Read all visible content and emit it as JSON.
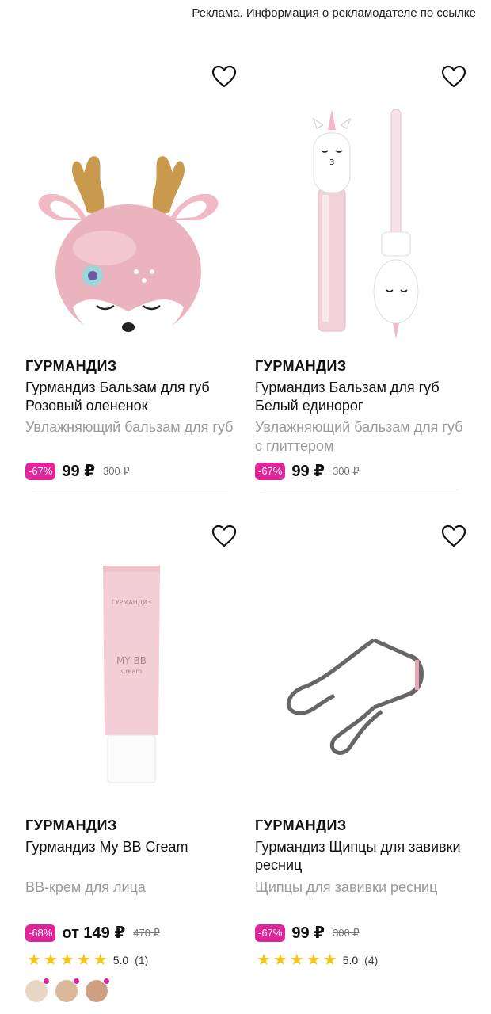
{
  "ad_notice": "Реклама. Информация о рекламодателе по ссылке",
  "products": [
    {
      "brand": "ГУРМАНДИЗ",
      "title": "Гурмандиз Бальзам для губ Розовый олененок",
      "description": "Увлажняющий бальзам для губ",
      "discount": "-67%",
      "price": "99 ₽",
      "old_price": "300 ₽",
      "image_icon": "deer-lip-balm"
    },
    {
      "brand": "ГУРМАНДИЗ",
      "title": "Гурмандиз Бальзам для губ Белый единорог",
      "description": "Увлажняющий бальзам для губ с глиттером",
      "discount": "-67%",
      "price": "99 ₽",
      "old_price": "300 ₽",
      "image_icon": "unicorn-lip-gloss"
    },
    {
      "brand": "ГУРМАНДИЗ",
      "title": "Гурмандиз My BB Cream",
      "description": "BB-крем для лица",
      "discount": "-68%",
      "price": "от 149 ₽",
      "old_price": "470 ₽",
      "rating_value": "5.0",
      "rating_count": "(1)",
      "rating_stars": 5,
      "swatch_colors": [
        "#e8d7c4",
        "#dcb89a",
        "#cf9f84"
      ],
      "image_icon": "bb-cream-tube",
      "tube_brand": "ГУРМАНДИЗ",
      "tube_name": "MY BB",
      "tube_sub": "Cream"
    },
    {
      "brand": "ГУРМАНДИЗ",
      "title": "Гурмандиз Щипцы для завивки ресниц",
      "description": "Щипцы для завивки ресниц",
      "discount": "-67%",
      "price": "99 ₽",
      "old_price": "300 ₽",
      "rating_value": "5.0",
      "rating_count": "(4)",
      "rating_stars": 5,
      "image_icon": "eyelash-curler"
    }
  ],
  "colors": {
    "accent": "#e0249a",
    "star": "#f5c518",
    "muted": "#9a9a9a"
  }
}
